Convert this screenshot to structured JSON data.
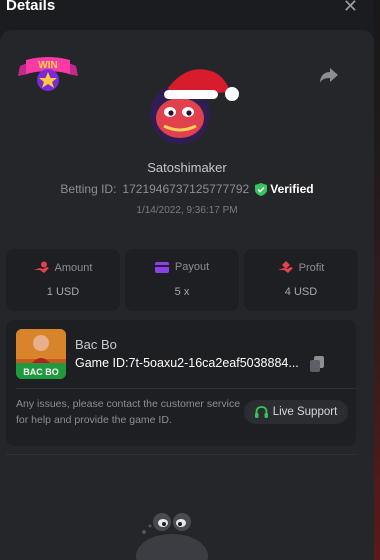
{
  "header": {
    "title": "Details",
    "close_symbol": "✕"
  },
  "badge": {
    "text": "WIN"
  },
  "profile": {
    "username": "Satoshimaker",
    "betting_id_label": "Betting ID:",
    "betting_id": "1721946737125777792",
    "verified_label": "Verified",
    "datetime": "1/14/2022, 9:36:17 PM"
  },
  "stats": [
    {
      "label": "Amount",
      "value": "1 USD",
      "icon": "hand-coins-icon"
    },
    {
      "label": "Payout",
      "value": "5 x",
      "icon": "card-icon"
    },
    {
      "label": "Profit",
      "value": "4 USD",
      "icon": "hand-money-icon"
    }
  ],
  "game": {
    "thumb_text": "BAC BO",
    "name": "Bac Bo",
    "id_label": "Game ID:",
    "id_value": "7t-5oaxu2-16ca2eaf5038884...",
    "issue_text": "Any issues, please contact the customer service for help and provide the game ID.",
    "support_label": "Live Support"
  },
  "colors": {
    "accent_red": "#e5414e",
    "purple": "#8a43e0",
    "green": "#35c45a"
  }
}
